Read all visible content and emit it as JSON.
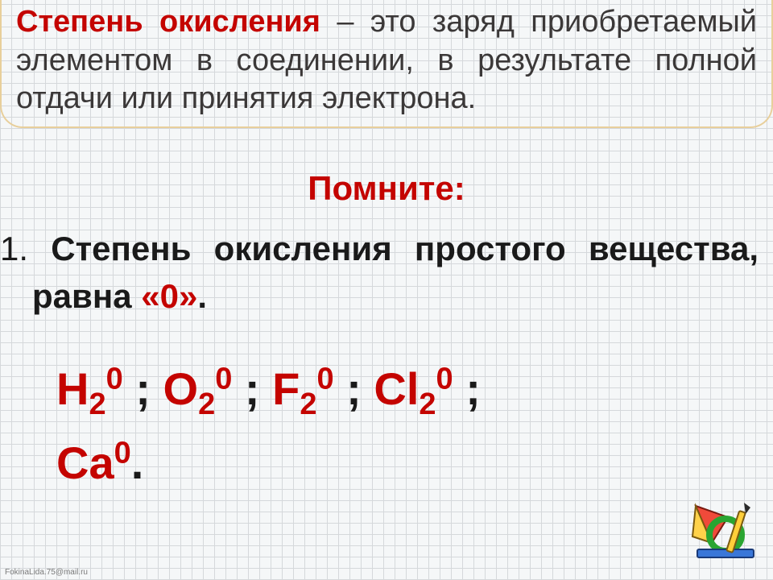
{
  "definition": {
    "term": "Степень окисления",
    "body_line1": " – это заряд приобретаемый элементом в соединении, в результате полной",
    "body_line2": "отдачи или принятия электрона."
  },
  "remember": "Помните:",
  "rule": {
    "number": "1.",
    "text_before": " Степень окисления простого вещества, равна ",
    "zero": "«0»",
    "text_after": "."
  },
  "formulas": {
    "items": [
      {
        "el": "H",
        "sub": "2",
        "sup": "0"
      },
      {
        "el": "O",
        "sub": "2",
        "sup": "0"
      },
      {
        "el": "F",
        "sub": "2",
        "sup": "0"
      },
      {
        "el": "Cl",
        "sub": "2",
        "sup": "0"
      },
      {
        "el": "Ca",
        "sub": "",
        "sup": "0"
      }
    ],
    "separator": " ; ",
    "terminator": "."
  },
  "credit": "FokinaLida.75@mail.ru"
}
